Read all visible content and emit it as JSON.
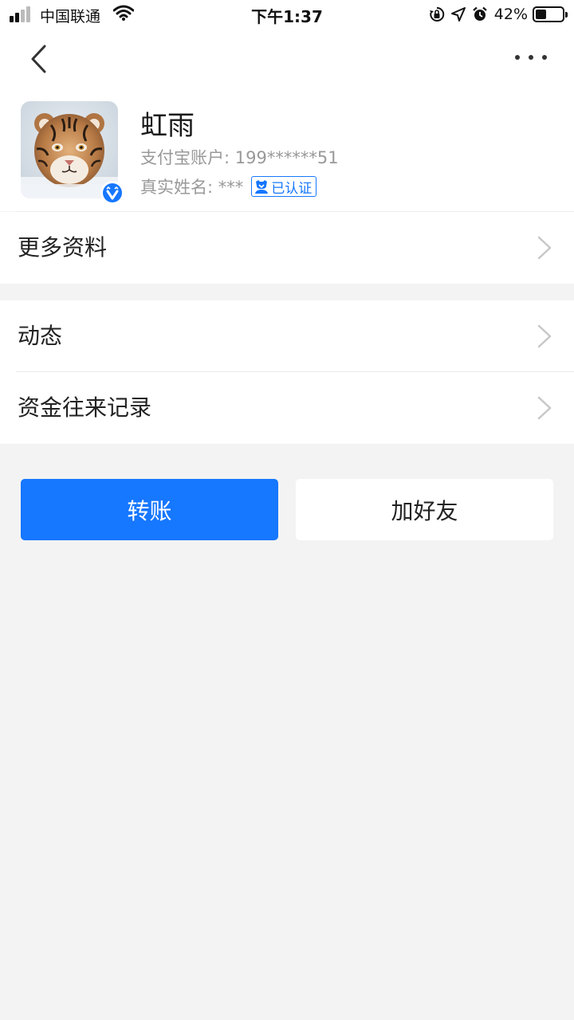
{
  "status_bar": {
    "carrier": "中国联通",
    "time": "下午1:37",
    "battery_percent": "42%",
    "battery_level": 0.42,
    "signal_bars_filled": 2,
    "icons": [
      "signal-icon",
      "wifi-icon",
      "orientation-lock-icon",
      "location-icon",
      "alarm-icon",
      "battery-icon"
    ]
  },
  "nav": {
    "back_icon": "chevron-left-icon",
    "more_icon": "more-dots-icon"
  },
  "profile": {
    "name": "虹雨",
    "account": "支付宝账户: 199******51",
    "real_name": "真实姓名: ***",
    "certified_label": "已认证",
    "avatar": "tiger-photo",
    "badge_icon": "verified-badge-icon"
  },
  "menu": {
    "more_info": "更多资料",
    "moments": "动态",
    "fund_records": "资金往来记录"
  },
  "actions": {
    "transfer": "转账",
    "add_friend": "加好友"
  },
  "colors": {
    "accent": "#1677ff",
    "background": "#f3f3f3",
    "secondary_text": "#999999"
  }
}
